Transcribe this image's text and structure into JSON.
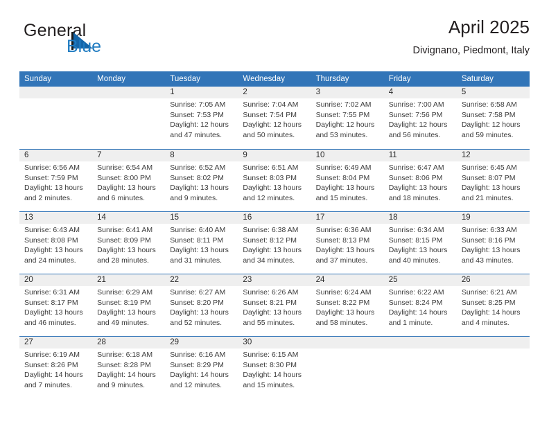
{
  "brand": {
    "name_part1": "General",
    "name_part2": "Blue",
    "logo_icon": "flag-triangle-icon"
  },
  "header": {
    "title": "April 2025",
    "subtitle": "Divignano, Piedmont, Italy"
  },
  "colors": {
    "header_blue": "#3275b8",
    "daynum_band": "#efefef",
    "brand_blue": "#1f7bc1",
    "text": "#231f20"
  },
  "weekdays": [
    "Sunday",
    "Monday",
    "Tuesday",
    "Wednesday",
    "Thursday",
    "Friday",
    "Saturday"
  ],
  "weeks": [
    [
      {
        "day": "",
        "l1": "",
        "l2": "",
        "l3": "",
        "l4": ""
      },
      {
        "day": "",
        "l1": "",
        "l2": "",
        "l3": "",
        "l4": ""
      },
      {
        "day": "1",
        "l1": "Sunrise: 7:05 AM",
        "l2": "Sunset: 7:53 PM",
        "l3": "Daylight: 12 hours",
        "l4": "and 47 minutes."
      },
      {
        "day": "2",
        "l1": "Sunrise: 7:04 AM",
        "l2": "Sunset: 7:54 PM",
        "l3": "Daylight: 12 hours",
        "l4": "and 50 minutes."
      },
      {
        "day": "3",
        "l1": "Sunrise: 7:02 AM",
        "l2": "Sunset: 7:55 PM",
        "l3": "Daylight: 12 hours",
        "l4": "and 53 minutes."
      },
      {
        "day": "4",
        "l1": "Sunrise: 7:00 AM",
        "l2": "Sunset: 7:56 PM",
        "l3": "Daylight: 12 hours",
        "l4": "and 56 minutes."
      },
      {
        "day": "5",
        "l1": "Sunrise: 6:58 AM",
        "l2": "Sunset: 7:58 PM",
        "l3": "Daylight: 12 hours",
        "l4": "and 59 minutes."
      }
    ],
    [
      {
        "day": "6",
        "l1": "Sunrise: 6:56 AM",
        "l2": "Sunset: 7:59 PM",
        "l3": "Daylight: 13 hours",
        "l4": "and 2 minutes."
      },
      {
        "day": "7",
        "l1": "Sunrise: 6:54 AM",
        "l2": "Sunset: 8:00 PM",
        "l3": "Daylight: 13 hours",
        "l4": "and 6 minutes."
      },
      {
        "day": "8",
        "l1": "Sunrise: 6:52 AM",
        "l2": "Sunset: 8:02 PM",
        "l3": "Daylight: 13 hours",
        "l4": "and 9 minutes."
      },
      {
        "day": "9",
        "l1": "Sunrise: 6:51 AM",
        "l2": "Sunset: 8:03 PM",
        "l3": "Daylight: 13 hours",
        "l4": "and 12 minutes."
      },
      {
        "day": "10",
        "l1": "Sunrise: 6:49 AM",
        "l2": "Sunset: 8:04 PM",
        "l3": "Daylight: 13 hours",
        "l4": "and 15 minutes."
      },
      {
        "day": "11",
        "l1": "Sunrise: 6:47 AM",
        "l2": "Sunset: 8:06 PM",
        "l3": "Daylight: 13 hours",
        "l4": "and 18 minutes."
      },
      {
        "day": "12",
        "l1": "Sunrise: 6:45 AM",
        "l2": "Sunset: 8:07 PM",
        "l3": "Daylight: 13 hours",
        "l4": "and 21 minutes."
      }
    ],
    [
      {
        "day": "13",
        "l1": "Sunrise: 6:43 AM",
        "l2": "Sunset: 8:08 PM",
        "l3": "Daylight: 13 hours",
        "l4": "and 24 minutes."
      },
      {
        "day": "14",
        "l1": "Sunrise: 6:41 AM",
        "l2": "Sunset: 8:09 PM",
        "l3": "Daylight: 13 hours",
        "l4": "and 28 minutes."
      },
      {
        "day": "15",
        "l1": "Sunrise: 6:40 AM",
        "l2": "Sunset: 8:11 PM",
        "l3": "Daylight: 13 hours",
        "l4": "and 31 minutes."
      },
      {
        "day": "16",
        "l1": "Sunrise: 6:38 AM",
        "l2": "Sunset: 8:12 PM",
        "l3": "Daylight: 13 hours",
        "l4": "and 34 minutes."
      },
      {
        "day": "17",
        "l1": "Sunrise: 6:36 AM",
        "l2": "Sunset: 8:13 PM",
        "l3": "Daylight: 13 hours",
        "l4": "and 37 minutes."
      },
      {
        "day": "18",
        "l1": "Sunrise: 6:34 AM",
        "l2": "Sunset: 8:15 PM",
        "l3": "Daylight: 13 hours",
        "l4": "and 40 minutes."
      },
      {
        "day": "19",
        "l1": "Sunrise: 6:33 AM",
        "l2": "Sunset: 8:16 PM",
        "l3": "Daylight: 13 hours",
        "l4": "and 43 minutes."
      }
    ],
    [
      {
        "day": "20",
        "l1": "Sunrise: 6:31 AM",
        "l2": "Sunset: 8:17 PM",
        "l3": "Daylight: 13 hours",
        "l4": "and 46 minutes."
      },
      {
        "day": "21",
        "l1": "Sunrise: 6:29 AM",
        "l2": "Sunset: 8:19 PM",
        "l3": "Daylight: 13 hours",
        "l4": "and 49 minutes."
      },
      {
        "day": "22",
        "l1": "Sunrise: 6:27 AM",
        "l2": "Sunset: 8:20 PM",
        "l3": "Daylight: 13 hours",
        "l4": "and 52 minutes."
      },
      {
        "day": "23",
        "l1": "Sunrise: 6:26 AM",
        "l2": "Sunset: 8:21 PM",
        "l3": "Daylight: 13 hours",
        "l4": "and 55 minutes."
      },
      {
        "day": "24",
        "l1": "Sunrise: 6:24 AM",
        "l2": "Sunset: 8:22 PM",
        "l3": "Daylight: 13 hours",
        "l4": "and 58 minutes."
      },
      {
        "day": "25",
        "l1": "Sunrise: 6:22 AM",
        "l2": "Sunset: 8:24 PM",
        "l3": "Daylight: 14 hours",
        "l4": "and 1 minute."
      },
      {
        "day": "26",
        "l1": "Sunrise: 6:21 AM",
        "l2": "Sunset: 8:25 PM",
        "l3": "Daylight: 14 hours",
        "l4": "and 4 minutes."
      }
    ],
    [
      {
        "day": "27",
        "l1": "Sunrise: 6:19 AM",
        "l2": "Sunset: 8:26 PM",
        "l3": "Daylight: 14 hours",
        "l4": "and 7 minutes."
      },
      {
        "day": "28",
        "l1": "Sunrise: 6:18 AM",
        "l2": "Sunset: 8:28 PM",
        "l3": "Daylight: 14 hours",
        "l4": "and 9 minutes."
      },
      {
        "day": "29",
        "l1": "Sunrise: 6:16 AM",
        "l2": "Sunset: 8:29 PM",
        "l3": "Daylight: 14 hours",
        "l4": "and 12 minutes."
      },
      {
        "day": "30",
        "l1": "Sunrise: 6:15 AM",
        "l2": "Sunset: 8:30 PM",
        "l3": "Daylight: 14 hours",
        "l4": "and 15 minutes."
      },
      {
        "day": "",
        "l1": "",
        "l2": "",
        "l3": "",
        "l4": ""
      },
      {
        "day": "",
        "l1": "",
        "l2": "",
        "l3": "",
        "l4": ""
      },
      {
        "day": "",
        "l1": "",
        "l2": "",
        "l3": "",
        "l4": ""
      }
    ]
  ]
}
